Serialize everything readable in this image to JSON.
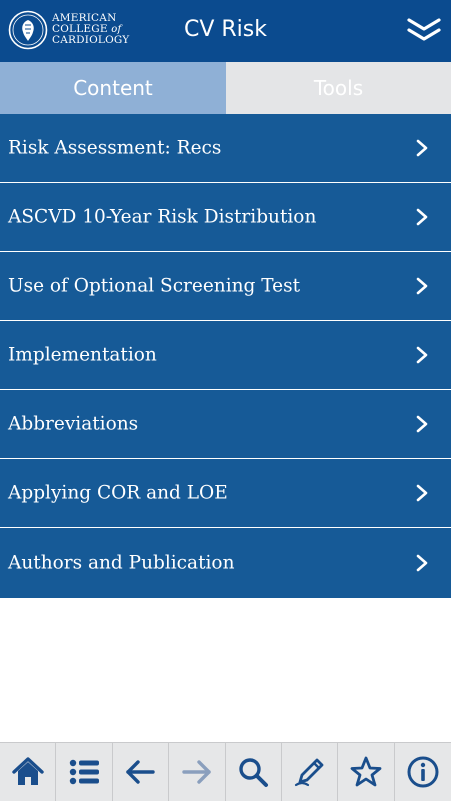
{
  "header": {
    "logo_lines": [
      "AMERICAN",
      "COLLEGE",
      "of",
      "CARDIOLOGY"
    ],
    "title": "CV Risk",
    "collapse_icon": "double-chevron-down-icon"
  },
  "tabs": [
    {
      "label": "Content",
      "active": true
    },
    {
      "label": "Tools",
      "active": false
    }
  ],
  "menu": {
    "items": [
      {
        "label": "Risk Assessment: Recs"
      },
      {
        "label": "ASCVD 10-Year Risk Distribution"
      },
      {
        "label": "Use of Optional Screening Test"
      },
      {
        "label": "Implementation"
      },
      {
        "label": "Abbreviations"
      },
      {
        "label": "Applying COR and LOE"
      },
      {
        "label": "Authors and Publication"
      }
    ]
  },
  "toolbar": {
    "buttons": [
      {
        "icon": "home-icon"
      },
      {
        "icon": "list-icon",
        "active": true
      },
      {
        "icon": "back-arrow-icon"
      },
      {
        "icon": "forward-arrow-icon",
        "disabled": true
      },
      {
        "icon": "search-icon"
      },
      {
        "icon": "pencil-icon"
      },
      {
        "icon": "star-icon"
      },
      {
        "icon": "info-icon"
      }
    ]
  },
  "colors": {
    "header_bg": "#0b4b8f",
    "menu_bg": "#165a97",
    "tab_active_bg": "#8fb0d6",
    "tab_inactive_bg": "#e4e5e7",
    "toolbar_bg": "#e6e7e8",
    "toolbar_icon": "#1a4e8c"
  }
}
